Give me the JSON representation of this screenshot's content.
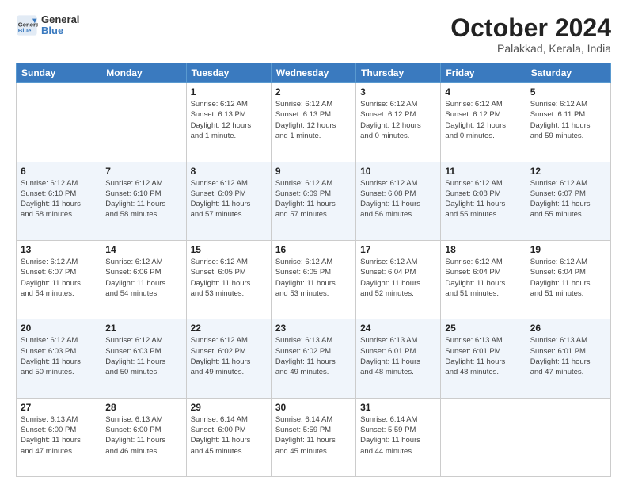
{
  "header": {
    "logo_line1": "General",
    "logo_line2": "Blue",
    "month": "October 2024",
    "location": "Palakkad, Kerala, India"
  },
  "days_of_week": [
    "Sunday",
    "Monday",
    "Tuesday",
    "Wednesday",
    "Thursday",
    "Friday",
    "Saturday"
  ],
  "weeks": [
    [
      {
        "day": "",
        "info": ""
      },
      {
        "day": "",
        "info": ""
      },
      {
        "day": "1",
        "info": "Sunrise: 6:12 AM\nSunset: 6:13 PM\nDaylight: 12 hours\nand 1 minute."
      },
      {
        "day": "2",
        "info": "Sunrise: 6:12 AM\nSunset: 6:13 PM\nDaylight: 12 hours\nand 1 minute."
      },
      {
        "day": "3",
        "info": "Sunrise: 6:12 AM\nSunset: 6:12 PM\nDaylight: 12 hours\nand 0 minutes."
      },
      {
        "day": "4",
        "info": "Sunrise: 6:12 AM\nSunset: 6:12 PM\nDaylight: 12 hours\nand 0 minutes."
      },
      {
        "day": "5",
        "info": "Sunrise: 6:12 AM\nSunset: 6:11 PM\nDaylight: 11 hours\nand 59 minutes."
      }
    ],
    [
      {
        "day": "6",
        "info": "Sunrise: 6:12 AM\nSunset: 6:10 PM\nDaylight: 11 hours\nand 58 minutes."
      },
      {
        "day": "7",
        "info": "Sunrise: 6:12 AM\nSunset: 6:10 PM\nDaylight: 11 hours\nand 58 minutes."
      },
      {
        "day": "8",
        "info": "Sunrise: 6:12 AM\nSunset: 6:09 PM\nDaylight: 11 hours\nand 57 minutes."
      },
      {
        "day": "9",
        "info": "Sunrise: 6:12 AM\nSunset: 6:09 PM\nDaylight: 11 hours\nand 57 minutes."
      },
      {
        "day": "10",
        "info": "Sunrise: 6:12 AM\nSunset: 6:08 PM\nDaylight: 11 hours\nand 56 minutes."
      },
      {
        "day": "11",
        "info": "Sunrise: 6:12 AM\nSunset: 6:08 PM\nDaylight: 11 hours\nand 55 minutes."
      },
      {
        "day": "12",
        "info": "Sunrise: 6:12 AM\nSunset: 6:07 PM\nDaylight: 11 hours\nand 55 minutes."
      }
    ],
    [
      {
        "day": "13",
        "info": "Sunrise: 6:12 AM\nSunset: 6:07 PM\nDaylight: 11 hours\nand 54 minutes."
      },
      {
        "day": "14",
        "info": "Sunrise: 6:12 AM\nSunset: 6:06 PM\nDaylight: 11 hours\nand 54 minutes."
      },
      {
        "day": "15",
        "info": "Sunrise: 6:12 AM\nSunset: 6:05 PM\nDaylight: 11 hours\nand 53 minutes."
      },
      {
        "day": "16",
        "info": "Sunrise: 6:12 AM\nSunset: 6:05 PM\nDaylight: 11 hours\nand 53 minutes."
      },
      {
        "day": "17",
        "info": "Sunrise: 6:12 AM\nSunset: 6:04 PM\nDaylight: 11 hours\nand 52 minutes."
      },
      {
        "day": "18",
        "info": "Sunrise: 6:12 AM\nSunset: 6:04 PM\nDaylight: 11 hours\nand 51 minutes."
      },
      {
        "day": "19",
        "info": "Sunrise: 6:12 AM\nSunset: 6:04 PM\nDaylight: 11 hours\nand 51 minutes."
      }
    ],
    [
      {
        "day": "20",
        "info": "Sunrise: 6:12 AM\nSunset: 6:03 PM\nDaylight: 11 hours\nand 50 minutes."
      },
      {
        "day": "21",
        "info": "Sunrise: 6:12 AM\nSunset: 6:03 PM\nDaylight: 11 hours\nand 50 minutes."
      },
      {
        "day": "22",
        "info": "Sunrise: 6:12 AM\nSunset: 6:02 PM\nDaylight: 11 hours\nand 49 minutes."
      },
      {
        "day": "23",
        "info": "Sunrise: 6:13 AM\nSunset: 6:02 PM\nDaylight: 11 hours\nand 49 minutes."
      },
      {
        "day": "24",
        "info": "Sunrise: 6:13 AM\nSunset: 6:01 PM\nDaylight: 11 hours\nand 48 minutes."
      },
      {
        "day": "25",
        "info": "Sunrise: 6:13 AM\nSunset: 6:01 PM\nDaylight: 11 hours\nand 48 minutes."
      },
      {
        "day": "26",
        "info": "Sunrise: 6:13 AM\nSunset: 6:01 PM\nDaylight: 11 hours\nand 47 minutes."
      }
    ],
    [
      {
        "day": "27",
        "info": "Sunrise: 6:13 AM\nSunset: 6:00 PM\nDaylight: 11 hours\nand 47 minutes."
      },
      {
        "day": "28",
        "info": "Sunrise: 6:13 AM\nSunset: 6:00 PM\nDaylight: 11 hours\nand 46 minutes."
      },
      {
        "day": "29",
        "info": "Sunrise: 6:14 AM\nSunset: 6:00 PM\nDaylight: 11 hours\nand 45 minutes."
      },
      {
        "day": "30",
        "info": "Sunrise: 6:14 AM\nSunset: 5:59 PM\nDaylight: 11 hours\nand 45 minutes."
      },
      {
        "day": "31",
        "info": "Sunrise: 6:14 AM\nSunset: 5:59 PM\nDaylight: 11 hours\nand 44 minutes."
      },
      {
        "day": "",
        "info": ""
      },
      {
        "day": "",
        "info": ""
      }
    ]
  ]
}
